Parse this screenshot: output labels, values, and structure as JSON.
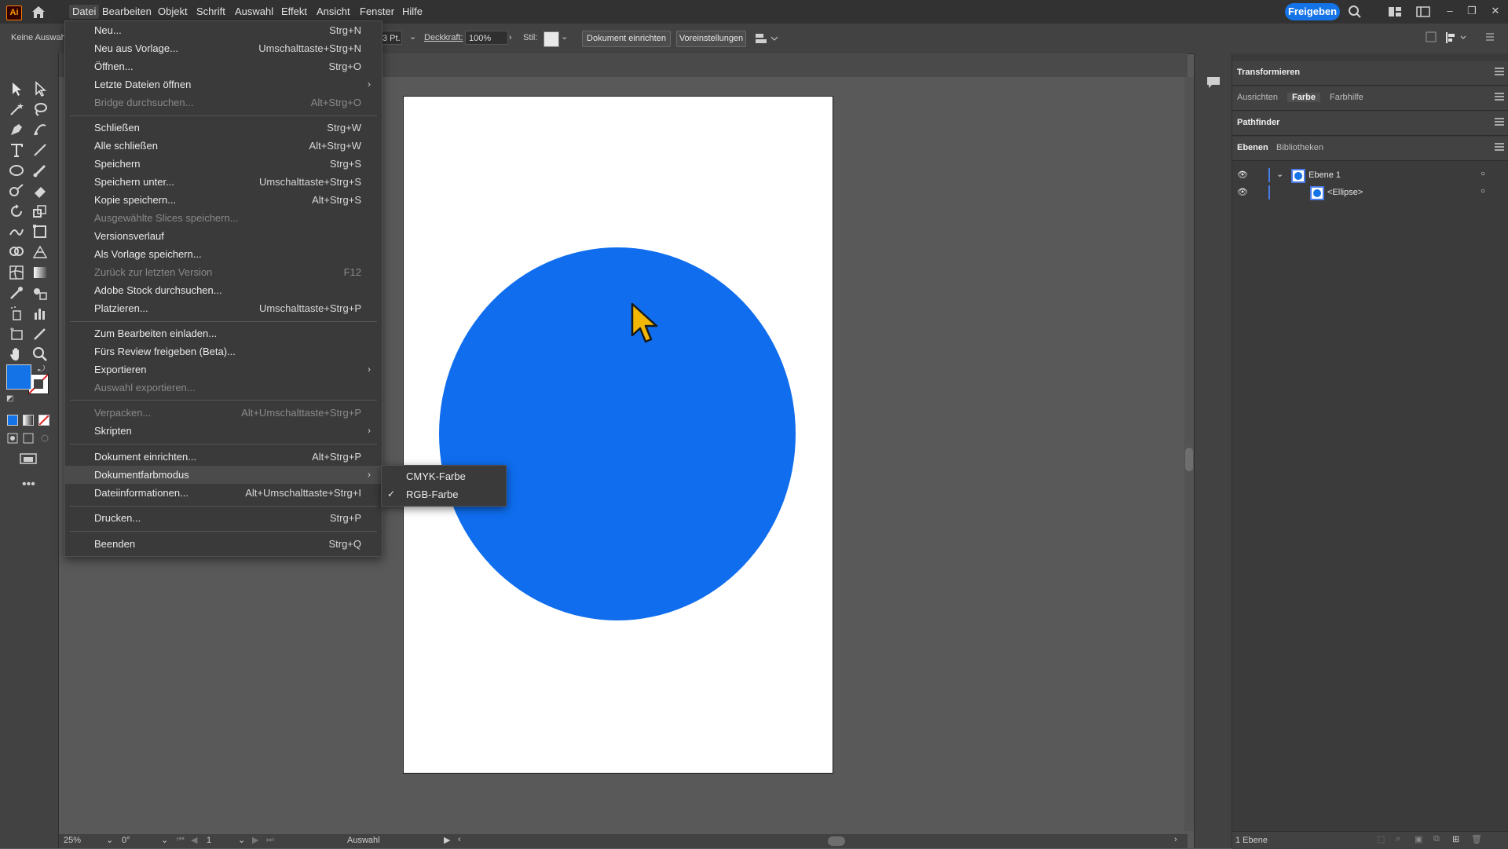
{
  "app": {
    "logo": "Ai"
  },
  "menubar": {
    "items": [
      "Datei",
      "Bearbeiten",
      "Objekt",
      "Schrift",
      "Auswahl",
      "Effekt",
      "Ansicht",
      "Fenster",
      "Hilfe"
    ],
    "share_label": "Freigeben"
  },
  "controlbar": {
    "selection_label": "Keine Auswahl",
    "stroke_value": "3 Pt.",
    "opacity_label": "Deckkraft:",
    "opacity_value": "100%",
    "style_label": "Stil:",
    "doc_setup_button": "Dokument einrichten",
    "prefs_button": "Voreinstellungen"
  },
  "file_menu": {
    "items": [
      {
        "label": "Neu...",
        "shortcut": "Strg+N"
      },
      {
        "label": "Neu aus Vorlage...",
        "shortcut": "Umschalttaste+Strg+N"
      },
      {
        "label": "Öffnen...",
        "shortcut": "Strg+O"
      },
      {
        "label": "Letzte Dateien öffnen",
        "shortcut": "",
        "submenu": true
      },
      {
        "label": "Bridge durchsuchen...",
        "shortcut": "Alt+Strg+O",
        "disabled": true
      },
      {
        "label": "Schließen",
        "shortcut": "Strg+W"
      },
      {
        "label": "Alle schließen",
        "shortcut": "Alt+Strg+W"
      },
      {
        "label": "Speichern",
        "shortcut": "Strg+S"
      },
      {
        "label": "Speichern unter...",
        "shortcut": "Umschalttaste+Strg+S"
      },
      {
        "label": "Kopie speichern...",
        "shortcut": "Alt+Strg+S"
      },
      {
        "label": "Ausgewählte Slices speichern...",
        "shortcut": "",
        "disabled": true
      },
      {
        "label": "Versionsverlauf",
        "shortcut": ""
      },
      {
        "label": "Als Vorlage speichern...",
        "shortcut": ""
      },
      {
        "label": "Zurück zur letzten Version",
        "shortcut": "F12",
        "disabled": true
      },
      {
        "label": "Adobe Stock durchsuchen...",
        "shortcut": ""
      },
      {
        "label": "Platzieren...",
        "shortcut": "Umschalttaste+Strg+P"
      },
      {
        "label": "Zum Bearbeiten einladen...",
        "shortcut": ""
      },
      {
        "label": "Fürs Review freigeben (Beta)...",
        "shortcut": ""
      },
      {
        "label": "Exportieren",
        "shortcut": "",
        "submenu": true
      },
      {
        "label": "Auswahl exportieren...",
        "shortcut": "",
        "disabled": true
      },
      {
        "label": "Verpacken...",
        "shortcut": "Alt+Umschalttaste+Strg+P",
        "disabled": true
      },
      {
        "label": "Skripten",
        "shortcut": "",
        "submenu": true
      },
      {
        "label": "Dokument einrichten...",
        "shortcut": "Alt+Strg+P"
      },
      {
        "label": "Dokumentfarbmodus",
        "shortcut": "",
        "submenu": true,
        "highlighted": true
      },
      {
        "label": "Dateiinformationen...",
        "shortcut": "Alt+Umschalttaste+Strg+I"
      },
      {
        "label": "Drucken...",
        "shortcut": "Strg+P"
      },
      {
        "label": "Beenden",
        "shortcut": "Strg+Q"
      }
    ]
  },
  "color_mode_submenu": {
    "items": [
      {
        "label": "CMYK-Farbe",
        "checked": false
      },
      {
        "label": "RGB-Farbe",
        "checked": true
      }
    ]
  },
  "right_panel": {
    "transform_title": "Transformieren",
    "tabs_row1": [
      "Ausrichten",
      "Farbe",
      "Farbhilfe"
    ],
    "pathfinder_title": "Pathfinder",
    "tabs_row3": [
      "Ebenen",
      "Bibliotheken"
    ],
    "layers": [
      {
        "name": "Ebene 1"
      },
      {
        "name": "<Ellipse>"
      }
    ],
    "footer": "1 Ebene"
  },
  "statusbar": {
    "zoom": "25%",
    "rotation": "0°",
    "artboard_number": "1",
    "mode": "Auswahl"
  },
  "colors": {
    "ellipse_fill": "#0f6dee",
    "accent": "#1473e6",
    "fill_swatch": "#1473e6"
  }
}
